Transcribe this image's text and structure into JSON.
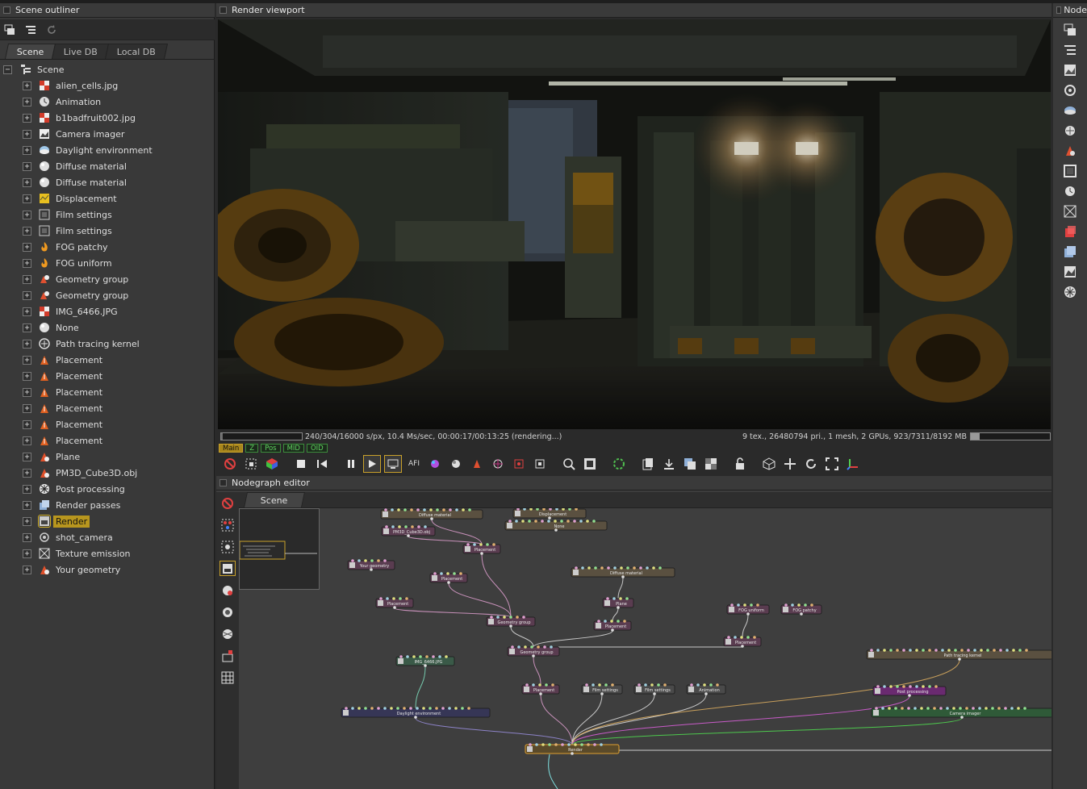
{
  "outliner": {
    "title": "Scene outliner",
    "tabs": [
      {
        "label": "Scene"
      },
      {
        "label": "Live DB"
      },
      {
        "label": "Local DB"
      }
    ],
    "root": {
      "label": "Scene",
      "expander": "−"
    },
    "items": [
      {
        "label": "alien_cells.jpg",
        "icon": "image-texture-icon",
        "color": "#d23b2a"
      },
      {
        "label": "Animation",
        "icon": "clock-icon",
        "color": "#dddddd"
      },
      {
        "label": "b1badfruit002.jpg",
        "icon": "image-texture-icon",
        "color": "#d23b2a"
      },
      {
        "label": "Camera imager",
        "icon": "imager-icon",
        "color": "#eeeeee"
      },
      {
        "label": "Daylight environment",
        "icon": "environment-icon",
        "color": "#9fc7e8"
      },
      {
        "label": "Diffuse material",
        "icon": "material-sphere-icon",
        "color": "#e0e0e0"
      },
      {
        "label": "Diffuse material",
        "icon": "material-sphere-icon",
        "color": "#e0e0e0"
      },
      {
        "label": "Displacement",
        "icon": "displacement-icon",
        "color": "#e8c020"
      },
      {
        "label": "Film settings",
        "icon": "film-icon",
        "color": "#cccccc"
      },
      {
        "label": "Film settings",
        "icon": "film-icon",
        "color": "#cccccc"
      },
      {
        "label": "FOG patchy",
        "icon": "fog-icon",
        "color": "#f09a20"
      },
      {
        "label": "FOG uniform",
        "icon": "fog-icon",
        "color": "#f09a20"
      },
      {
        "label": "Geometry group",
        "icon": "geometry-group-icon",
        "color": "#e05030"
      },
      {
        "label": "Geometry group",
        "icon": "geometry-group-icon",
        "color": "#e05030"
      },
      {
        "label": "IMG_6466.JPG",
        "icon": "image-texture-icon",
        "color": "#d23b2a"
      },
      {
        "label": "None",
        "icon": "material-sphere-icon",
        "color": "#e0e0e0"
      },
      {
        "label": "Path tracing kernel",
        "icon": "kernel-icon",
        "color": "#dddddd"
      },
      {
        "label": "Placement",
        "icon": "placement-icon",
        "color": "#e06020"
      },
      {
        "label": "Placement",
        "icon": "placement-icon",
        "color": "#e06020"
      },
      {
        "label": "Placement",
        "icon": "placement-icon",
        "color": "#e06020"
      },
      {
        "label": "Placement",
        "icon": "placement-icon",
        "color": "#e06020"
      },
      {
        "label": "Placement",
        "icon": "placement-icon",
        "color": "#e06020"
      },
      {
        "label": "Placement",
        "icon": "placement-icon",
        "color": "#e06020"
      },
      {
        "label": "Plane",
        "icon": "mesh-icon",
        "color": "#e0502a"
      },
      {
        "label": "PM3D_Cube3D.obj",
        "icon": "mesh-icon",
        "color": "#e0502a"
      },
      {
        "label": "Post processing",
        "icon": "post-processing-icon",
        "color": "#eeeeee"
      },
      {
        "label": "Render passes",
        "icon": "render-passes-icon",
        "color": "#8fb0d8"
      },
      {
        "label": "Render",
        "icon": "render-target-icon",
        "color": "#cccccc",
        "selected": true
      },
      {
        "label": "shot_camera",
        "icon": "camera-icon",
        "color": "#cccccc"
      },
      {
        "label": "Texture emission",
        "icon": "texture-emission-icon",
        "color": "#dddddd"
      },
      {
        "label": "Your geometry",
        "icon": "geometry-icon",
        "color": "#e0502a"
      }
    ]
  },
  "viewport": {
    "title": "Render viewport",
    "status_left": "240/304/16000 s/px, 10.4 Ms/sec, 00:00:17/00:13:25 (rendering...)",
    "status_right": "9 tex., 26480794 pri., 1 mesh, 2 GPUs, 923/7311/8192 MB",
    "progress": 0.02,
    "memory": 0.11,
    "passes": [
      {
        "label": "Main",
        "active": true
      },
      {
        "label": "Z"
      },
      {
        "label": "Pos"
      },
      {
        "label": "MID"
      },
      {
        "label": "OID"
      }
    ],
    "toolbar_text_afi": "AFI"
  },
  "nodegraph": {
    "title": "Nodegraph editor",
    "tab": "Scene",
    "nodes": [
      {
        "label": "Diffuse material",
        "color": "#5a5040"
      },
      {
        "label": "Displacement",
        "color": "#5a5040"
      },
      {
        "label": "PM3D_Cube3D.obj",
        "color": "#5a3c50"
      },
      {
        "label": "None",
        "color": "#5a5040"
      },
      {
        "label": "Placement",
        "color": "#5a3c50"
      },
      {
        "label": "Your geometry",
        "color": "#5a3c50"
      },
      {
        "label": "Placement",
        "color": "#5a3c50"
      },
      {
        "label": "Diffuse material",
        "color": "#5a5040"
      },
      {
        "label": "Placement",
        "color": "#5a3c50"
      },
      {
        "label": "Plane",
        "color": "#5a3c50"
      },
      {
        "label": "FOG uniform",
        "color": "#5a3c50"
      },
      {
        "label": "FOG patchy",
        "color": "#5a3c50"
      },
      {
        "label": "Geometry group",
        "color": "#5a3c50"
      },
      {
        "label": "Placement",
        "color": "#5a3c50"
      },
      {
        "label": "Placement",
        "color": "#5a3c50"
      },
      {
        "label": "Geometry group",
        "color": "#5a3c50"
      },
      {
        "label": "Path tracing kernel",
        "color": "#5a5040"
      },
      {
        "label": "IMG_6466.JPG",
        "color": "#3a5a48"
      },
      {
        "label": "Placement",
        "color": "#5a3c50"
      },
      {
        "label": "Film settings",
        "color": "#4a4a4a"
      },
      {
        "label": "Film settings",
        "color": "#4a4a4a"
      },
      {
        "label": "Animation",
        "color": "#4a4a4a"
      },
      {
        "label": "Post processing",
        "color": "#6a2a70"
      },
      {
        "label": "Daylight environment",
        "color": "#363656"
      },
      {
        "label": "Camera imager",
        "color": "#2f5a38"
      },
      {
        "label": "Render",
        "color": "#5a4a2a"
      }
    ]
  },
  "inspector": {
    "title": "Node"
  },
  "colors": {
    "accent": "#c9a12a",
    "selection": "#b8961e",
    "pass_green": "#5fd25f"
  }
}
